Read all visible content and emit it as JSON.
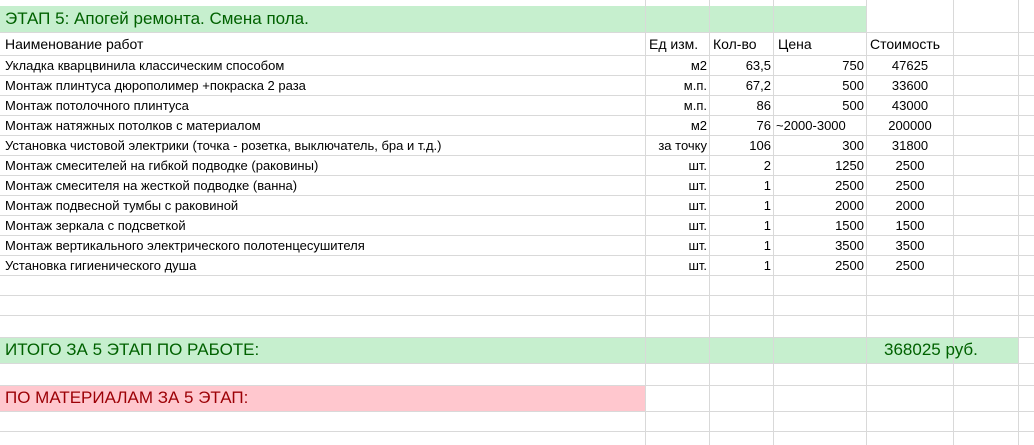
{
  "stage_title": "ЭТАП 5: Апогей ремонта. Смена пола.",
  "headers": {
    "name": "Наименование работ",
    "unit": "Ед изм.",
    "qty": "Кол-во",
    "price": "Цена",
    "cost": "Стоимость"
  },
  "rows": [
    {
      "name": "Укладка кварцвинила классическим способом",
      "unit": "м2",
      "qty": "63,5",
      "price": "750",
      "cost": "47625"
    },
    {
      "name": "Монтаж плинтуса дюрополимер +покраска 2 раза",
      "unit": "м.п.",
      "qty": "67,2",
      "price": "500",
      "cost": "33600"
    },
    {
      "name": "Монтаж потолочного плинтуса",
      "unit": "м.п.",
      "qty": "86",
      "price": "500",
      "cost": "43000"
    },
    {
      "name": "Монтаж натяжных потолков с материалом",
      "unit": "м2",
      "qty": "76",
      "price": "~2000-3000",
      "cost": "200000"
    },
    {
      "name": "Установка чистовой электрики (точка - розетка, выключатель, бра и т.д.)",
      "unit": "за точку",
      "qty": "106",
      "price": "300",
      "cost": "31800"
    },
    {
      "name": "Монтаж смесителей на гибкой подводке (раковины)",
      "unit": "шт.",
      "qty": "2",
      "price": "1250",
      "cost": "2500"
    },
    {
      "name": "Монтаж смесителя на жесткой подводке (ванна)",
      "unit": "шт.",
      "qty": "1",
      "price": "2500",
      "cost": "2500"
    },
    {
      "name": "Монтаж подвесной тумбы с раковиной",
      "unit": "шт.",
      "qty": "1",
      "price": "2000",
      "cost": "2000"
    },
    {
      "name": "Монтаж зеркала с подсветкой",
      "unit": "шт.",
      "qty": "1",
      "price": "1500",
      "cost": "1500"
    },
    {
      "name": "Монтаж вертикального электрического полотенцесушителя",
      "unit": "шт.",
      "qty": "1",
      "price": "3500",
      "cost": "3500"
    },
    {
      "name": "Установка гигиенического душа",
      "unit": "шт.",
      "qty": "1",
      "price": "2500",
      "cost": "2500"
    }
  ],
  "total_work_label": "ИТОГО ЗА 5 ЭТАП ПО РАБОТЕ:",
  "total_work_value": "368025 руб.",
  "materials_label": "ПО МАТЕРИАЛАМ ЗА 5 ЭТАП:",
  "colors": {
    "green_fill": "#c6efce",
    "green_text": "#006100",
    "pink_fill": "#ffc7ce",
    "red_text": "#9c0006",
    "grid": "#d9d9d9"
  }
}
